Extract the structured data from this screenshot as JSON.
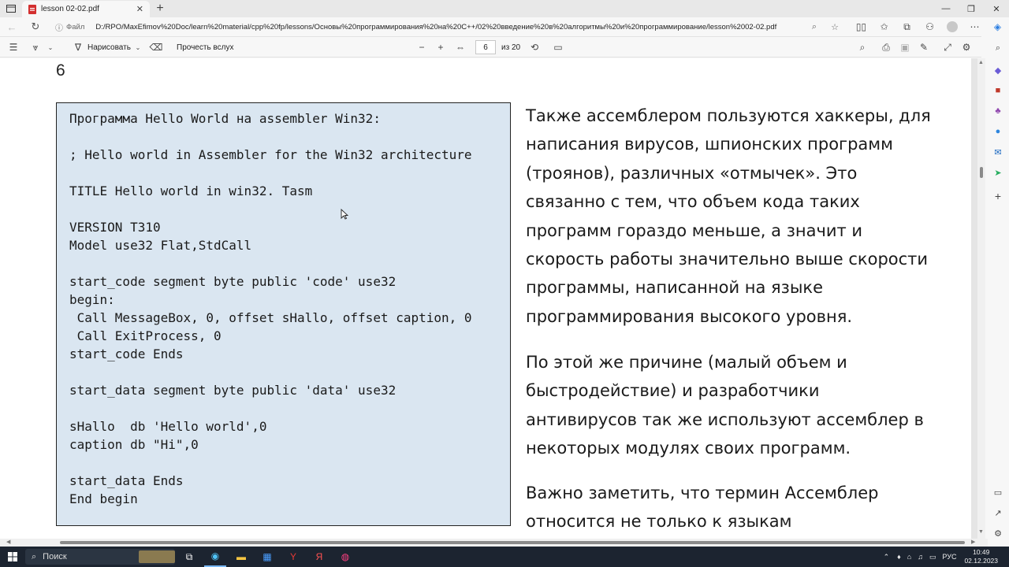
{
  "browser": {
    "tab_title": "lesson 02-02.pdf",
    "address_label": "Файл",
    "url": "D:/RPO/MaxEfimov%20Doc/learn%20material/cpp%20fp/lessons/Основы%20программирования%20на%20C++/02%20введение%20в%20алгоритмы%20и%20программирование/lesson%2002-02.pdf"
  },
  "pdf_toolbar": {
    "draw_label": "Нарисовать",
    "read_aloud_label": "Прочесть вслух",
    "page_current": "6",
    "page_total": "из 20"
  },
  "document": {
    "page_number": "6",
    "code_lines": [
      "Программа Hello World на assembler Win32:",
      "; Hello world in Assembler for the Win32 architecture",
      "TITLE Hello world in win32. Tasm",
      "VERSION T310",
      "Model use32 Flat,StdCall",
      "start_code segment byte public 'code' use32",
      "begin:",
      " Call MessageBox, 0, offset sHallo, offset caption, 0",
      " Call ExitProcess, 0",
      "start_code Ends",
      "start_data segment byte public 'data' use32",
      "sHallo  db 'Hello world',0",
      "caption db \"Hi\",0",
      "start_data Ends",
      "End begin"
    ],
    "paragraphs": [
      "Также ассемблером пользуются хаккеры, для написания вирусов, шпионских программ (троянов), различных «отмычек». Это связанно с тем, что объем кода таких программ гораздо меньше, а значит и скорость работы значительно выше скорости программы, написанной на языке программирования высокого уровня.",
      "По этой же причине (малый объем и быстродействие) и разработчики антивирусов так же используют ассемблер в некоторых модулях своих программ.",
      "Важно заметить, что термин Ассемблер относится не только к языкам"
    ]
  },
  "taskbar": {
    "search_label": "Поиск",
    "language": "РУС",
    "time": "10:49",
    "date": "02.12.2023"
  },
  "colors": {
    "code_background": "#dae6f1",
    "taskbar": "#1c2430"
  }
}
